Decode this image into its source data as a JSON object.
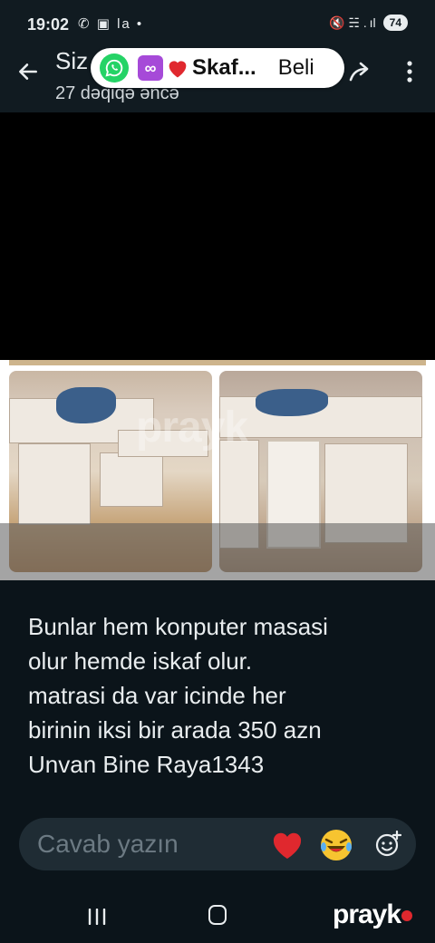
{
  "status_bar": {
    "time": "19:02",
    "left_icons": "✆ ▣ la •",
    "right_icons": "🔇 ☵ . ıl",
    "battery": "74"
  },
  "header": {
    "sender": "Siz",
    "time_ago": "27 dəqiqə əncə"
  },
  "chip": {
    "title": "Skaf...",
    "action": "Beli",
    "loop_symbol": "∞"
  },
  "media": {
    "watermark": "prayk"
  },
  "caption": "Bunlar hem konputer masasi\nolur hemde  iskaf  olur.\nmatrasi da var  icinde  her\nbirinin iksi bir arada  350 azn\nUnvan Bine Raya1343",
  "reply": {
    "placeholder": "Cavab yazın"
  },
  "brand": {
    "name": "prayk"
  },
  "colors": {
    "background": "#0b141a",
    "header": "#111b21",
    "whatsapp_green": "#25d366",
    "reply_bar": "#1f2c34",
    "heart_red": "#e0282e"
  }
}
